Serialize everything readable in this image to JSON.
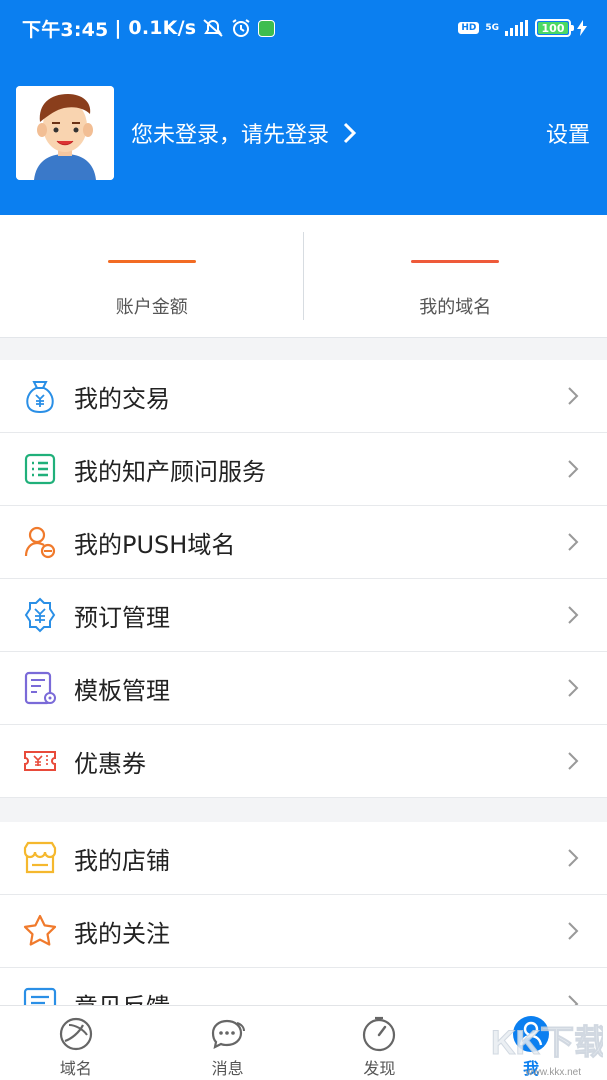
{
  "status_bar": {
    "time": "下午3:45",
    "speed": "| 0.1K/s",
    "hd": "HD",
    "net": "5G",
    "battery": "100"
  },
  "header": {
    "login_prompt": "您未登录，请先登录",
    "settings_label": "设置"
  },
  "stats": [
    {
      "label": "账户金额"
    },
    {
      "label": "我的域名"
    }
  ],
  "menu_group_1": [
    {
      "label": "我的交易",
      "icon": "money-bag-icon",
      "color": "#2a8fe6"
    },
    {
      "label": "我的知产顾问服务",
      "icon": "list-icon",
      "color": "#20b07a"
    },
    {
      "label": "我的PUSH域名",
      "icon": "user-push-icon",
      "color": "#f07a2c"
    },
    {
      "label": "预订管理",
      "icon": "yen-badge-icon",
      "color": "#2a8fe6"
    },
    {
      "label": "模板管理",
      "icon": "template-icon",
      "color": "#7a6ad8"
    },
    {
      "label": "优惠券",
      "icon": "coupon-icon",
      "color": "#e84a3a"
    }
  ],
  "menu_group_2": [
    {
      "label": "我的店铺",
      "icon": "shop-icon",
      "color": "#f5b82e"
    },
    {
      "label": "我的关注",
      "icon": "star-icon",
      "color": "#f07a2c"
    },
    {
      "label": "意见反馈",
      "icon": "feedback-icon",
      "color": "#2a8fe6"
    }
  ],
  "tabs": [
    {
      "label": "域名",
      "icon": "domain-icon"
    },
    {
      "label": "消息",
      "icon": "message-icon"
    },
    {
      "label": "发现",
      "icon": "compass-icon"
    },
    {
      "label": "我",
      "icon": "profile-icon",
      "active": true
    }
  ],
  "watermark": "www.kkx.net",
  "colors": {
    "primary": "#0b7ff0",
    "accent": "#f26b23"
  }
}
